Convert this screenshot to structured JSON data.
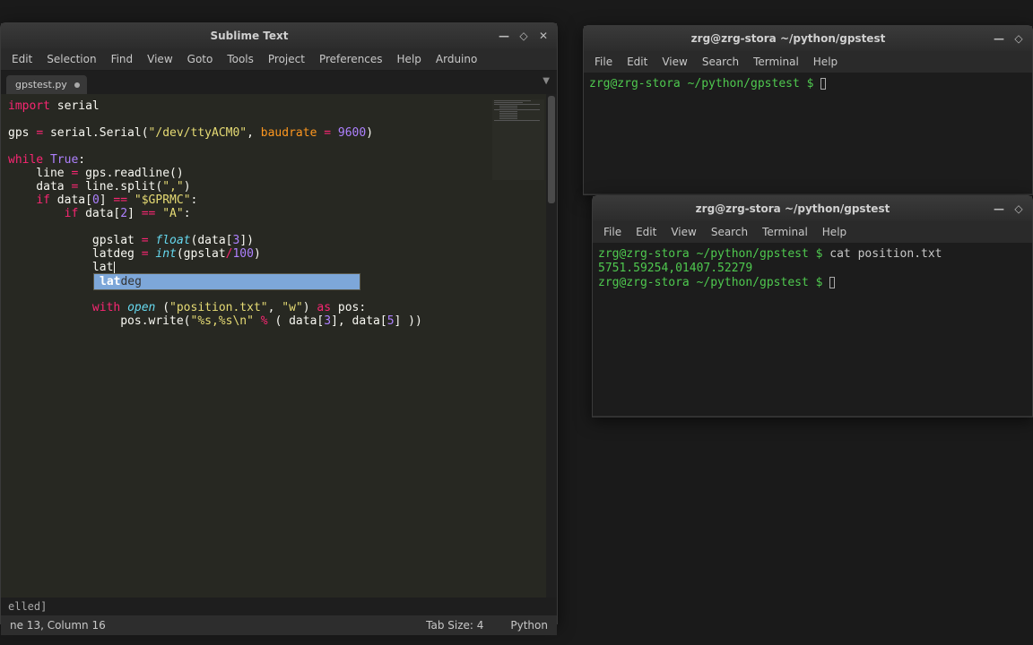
{
  "sublime": {
    "title": "Sublime Text",
    "menus": [
      "Edit",
      "Selection",
      "Find",
      "View",
      "Goto",
      "Tools",
      "Project",
      "Preferences",
      "Help",
      "Arduino"
    ],
    "tab": "gpstest.py",
    "code_tokens": [
      [
        [
          "import ",
          "kw"
        ],
        [
          "serial",
          ""
        ]
      ],
      [],
      [
        [
          "gps ",
          ""
        ],
        [
          "= ",
          "kw"
        ],
        [
          "serial.Serial(",
          ""
        ],
        [
          "\"/dev/ttyACM0\"",
          "str"
        ],
        [
          ", ",
          ""
        ],
        [
          "baudrate",
          "nm"
        ],
        [
          " ",
          ""
        ],
        [
          "= ",
          "kw"
        ],
        [
          "9600",
          "lit"
        ],
        [
          ")",
          ""
        ]
      ],
      [],
      [
        [
          "while ",
          "kw"
        ],
        [
          "True",
          "lit"
        ],
        [
          ":",
          ""
        ]
      ],
      [
        [
          "    line ",
          ""
        ],
        [
          "= ",
          "kw"
        ],
        [
          "gps.readline()",
          ""
        ]
      ],
      [
        [
          "    data ",
          ""
        ],
        [
          "= ",
          "kw"
        ],
        [
          "line.split(",
          ""
        ],
        [
          "\",\"",
          "str"
        ],
        [
          ")",
          ""
        ]
      ],
      [
        [
          "    ",
          ""
        ],
        [
          "if ",
          "kw"
        ],
        [
          "data[",
          ""
        ],
        [
          "0",
          "lit"
        ],
        [
          "] ",
          ""
        ],
        [
          "== ",
          "kw"
        ],
        [
          "\"$GPRMC\"",
          "str"
        ],
        [
          ":",
          ""
        ]
      ],
      [
        [
          "        ",
          ""
        ],
        [
          "if ",
          "kw"
        ],
        [
          "data[",
          ""
        ],
        [
          "2",
          "lit"
        ],
        [
          "] ",
          ""
        ],
        [
          "== ",
          "kw"
        ],
        [
          "\"A\"",
          "str"
        ],
        [
          ":",
          ""
        ]
      ],
      [],
      [
        [
          "            gpslat ",
          ""
        ],
        [
          "= ",
          "kw"
        ],
        [
          "float",
          "fn"
        ],
        [
          "(data[",
          ""
        ],
        [
          "3",
          "lit"
        ],
        [
          "])",
          ""
        ]
      ],
      [
        [
          "            latdeg ",
          ""
        ],
        [
          "= ",
          "kw"
        ],
        [
          "int",
          "fn"
        ],
        [
          "(gpslat",
          ""
        ],
        [
          "/",
          "kw"
        ],
        [
          "100",
          "lit"
        ],
        [
          ")",
          ""
        ]
      ],
      [
        [
          "            lat",
          ""
        ]
      ],
      [],
      [],
      [
        [
          "            ",
          ""
        ],
        [
          "with ",
          "kw"
        ],
        [
          "open ",
          "fn"
        ],
        [
          "(",
          ""
        ],
        [
          "\"position.txt\"",
          "str"
        ],
        [
          ", ",
          ""
        ],
        [
          "\"w\"",
          "str"
        ],
        [
          ") ",
          ""
        ],
        [
          "as ",
          "kw"
        ],
        [
          "pos:",
          ""
        ]
      ],
      [
        [
          "                pos.write(",
          ""
        ],
        [
          "\"%s,%s\\n\"",
          "str"
        ],
        [
          " ",
          ""
        ],
        [
          "% ",
          "kw"
        ],
        [
          "( data[",
          ""
        ],
        [
          "3",
          "lit"
        ],
        [
          "], data[",
          ""
        ],
        [
          "5",
          "lit"
        ],
        [
          "] ))",
          ""
        ]
      ]
    ],
    "autocomplete_match": "lat",
    "autocomplete_rest": "deg",
    "status_msg": "elled]",
    "status_left": "ne 13, Column 16",
    "status_mid": "Tab Size: 4",
    "status_right": "Python"
  },
  "term1": {
    "title": "zrg@zrg-stora ~/python/gpstest",
    "menus": [
      "File",
      "Edit",
      "View",
      "Search",
      "Terminal",
      "Help"
    ],
    "prompt": "zrg@zrg-stora ~/python/gpstest $ "
  },
  "term2": {
    "title": "zrg@zrg-stora ~/python/gpstest",
    "menus": [
      "File",
      "Edit",
      "View",
      "Search",
      "Terminal",
      "Help"
    ],
    "prompt1": "zrg@zrg-stora ~/python/gpstest $ ",
    "cmd1": "cat position.txt",
    "output": "5751.59254,01407.52279",
    "prompt2": "zrg@zrg-stora ~/python/gpstest $ "
  }
}
